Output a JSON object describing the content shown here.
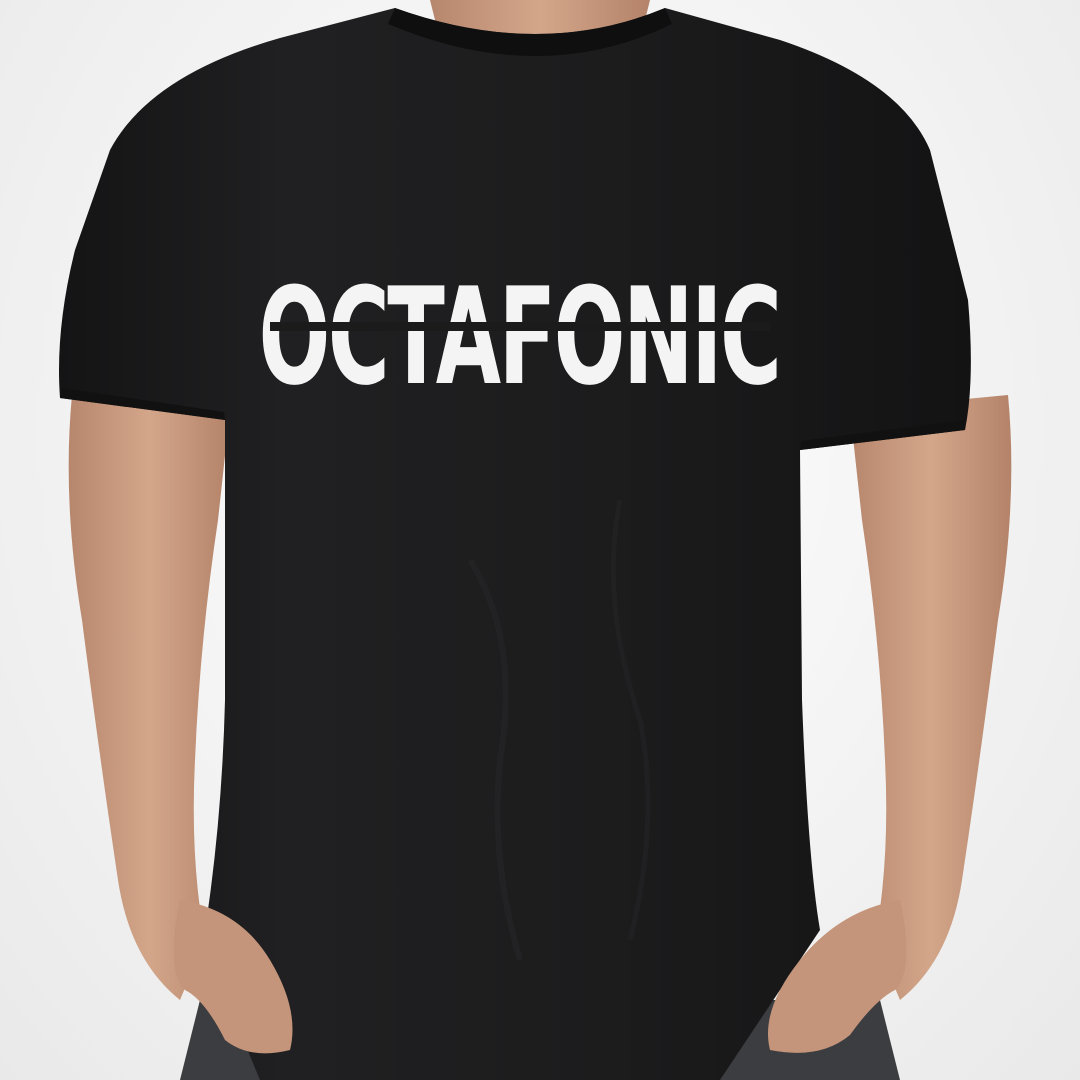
{
  "photo": {
    "subject": "tshirt-mockup",
    "shirt_color": "#1b1b1c",
    "skin_color": "#c99a7f",
    "background_color": "#f2f2f2"
  },
  "shirt": {
    "print_text": "OCTAFONIC",
    "print_color": "#f4f4f4"
  }
}
